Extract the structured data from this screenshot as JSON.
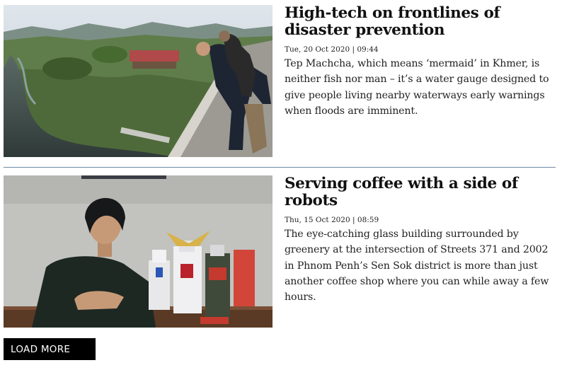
{
  "articles": [
    {
      "headline": "High-tech on frontlines of disaster prevention",
      "meta": "Tue, 20 Oct 2020 | 09:44",
      "excerpt": "Tep Machcha, which means ‘mermaid’ in Khmer, is neither fish nor man – it’s a water gauge designed to give people living nearby waterways early warnings when floods are imminent."
    },
    {
      "headline": "Serving coffee with a side of robots",
      "meta": "Thu, 15 Oct 2020 | 08:59",
      "excerpt": "The eye-catching glass building surrounded by greenery at the intersection of Streets 371 and 2002 in Phnom Penh’s Sen Sok district is more than just another coffee shop where you can while away a few hours."
    }
  ],
  "load_more": {
    "label": "LOAD MORE"
  },
  "colors": {
    "divider": "#6f8aa6",
    "button_bg": "#000000",
    "button_text": "#ffffff"
  }
}
